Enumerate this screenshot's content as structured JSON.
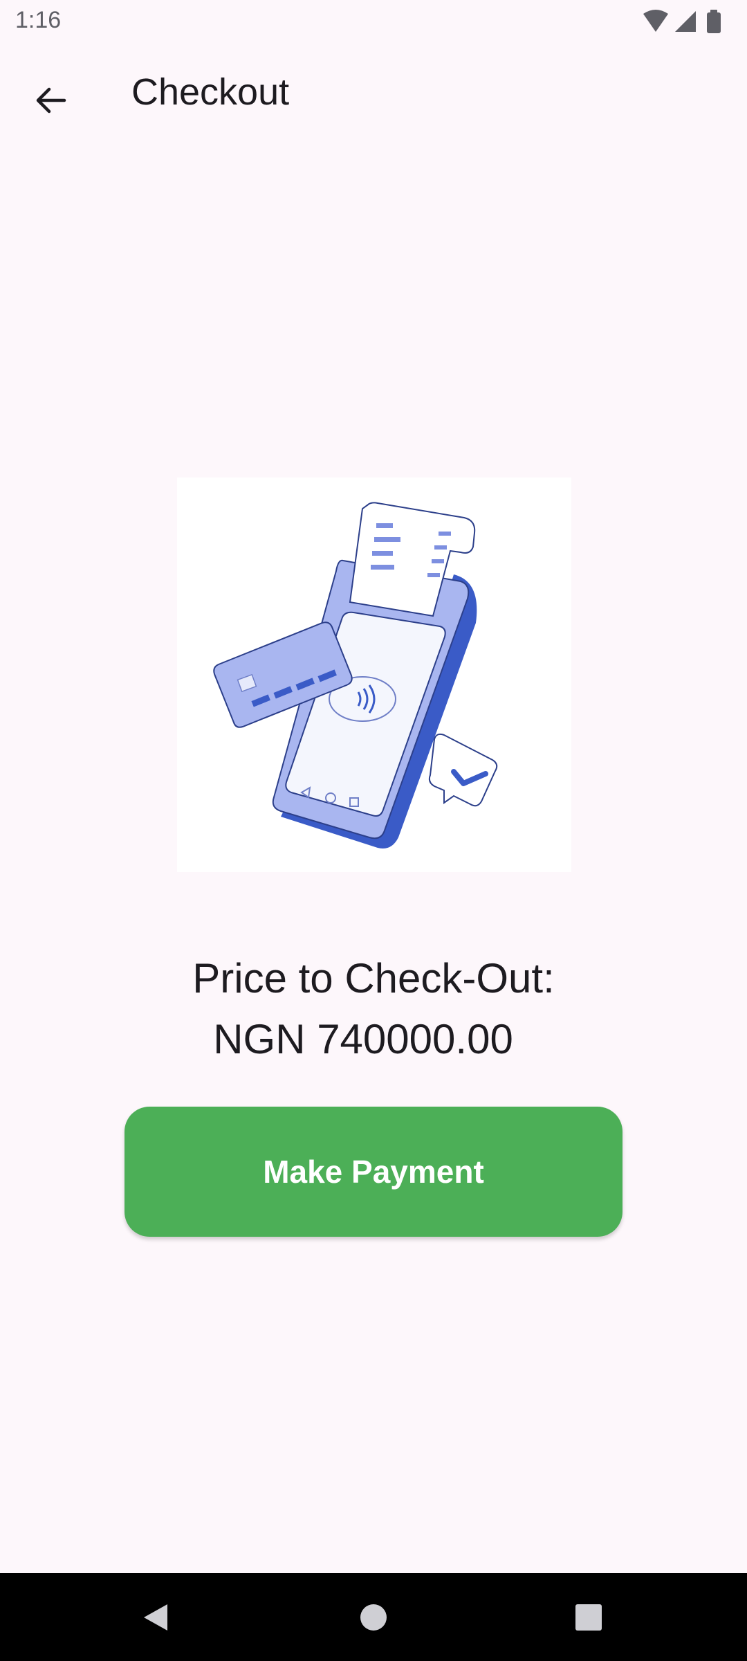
{
  "status_bar": {
    "time": "1:16",
    "icons": [
      "wifi-icon",
      "signal-icon",
      "battery-icon"
    ]
  },
  "app_bar": {
    "title": "Checkout",
    "back_icon": "arrow-back-icon"
  },
  "illustration": {
    "subject": "payment-terminal-illustration",
    "accent_color": "#3a5bc7",
    "light_color": "#a9b6f0"
  },
  "checkout": {
    "price_label": "Price to Check-Out:",
    "price_value": "NGN 740000.00",
    "pay_button_label": "Make Payment",
    "pay_button_color": "#4caf57"
  },
  "nav_bar": {
    "buttons": [
      "back-triangle-icon",
      "home-circle-icon",
      "recents-square-icon"
    ]
  }
}
